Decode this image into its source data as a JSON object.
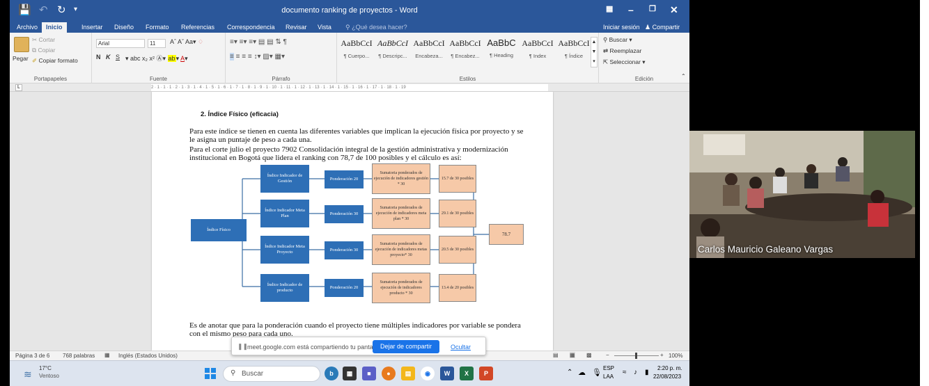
{
  "window": {
    "title": "documento ranking de proyectos  -  Word"
  },
  "menu": {
    "tabs": [
      "Archivo",
      "Inicio",
      "Insertar",
      "Diseño",
      "Formato",
      "Referencias",
      "Correspondencia",
      "Revisar",
      "Vista"
    ],
    "search": "¿Qué desea hacer?",
    "signin": "Iniciar sesión",
    "share": "Compartir"
  },
  "ribbon": {
    "clipboard": {
      "paste": "Pegar",
      "cut": "Cortar",
      "copy": "Copiar",
      "format": "Copiar formato",
      "label": "Portapapeles"
    },
    "font": {
      "name": "Arial",
      "size": "11",
      "label": "Fuente",
      "bold": "N",
      "italic": "K",
      "underline": "S"
    },
    "paragraph": {
      "label": "Párrafo"
    },
    "styles": {
      "items": [
        {
          "sample": "AaBbCcI",
          "name": "¶ Cuerpo..."
        },
        {
          "sample": "AaBbCcI",
          "name": "¶ Descripc..."
        },
        {
          "sample": "AaBbCcI",
          "name": "Encabeza..."
        },
        {
          "sample": "AaBbCcI",
          "name": "¶ Encabez..."
        },
        {
          "sample": "AaBbC",
          "name": "¶ Heading"
        },
        {
          "sample": "AaBbCcI",
          "name": "¶ Index"
        },
        {
          "sample": "AaBbCcI",
          "name": "¶ Índice"
        }
      ],
      "label": "Estilos"
    },
    "editing": {
      "find": "Buscar",
      "replace": "Reemplazar",
      "select": "Seleccionar",
      "label": "Edición"
    }
  },
  "ruler": "2 · 1 · 1 · 1 · 2 · 1 · 3 · 1 · 4 · 1 · 5 · 1 · 6 · 1 · 7 · 1 · 8 · 1 · 9 · 1 · 10 · 1 · 11 · 1 · 12 · 1 · 13 · 1 · 14 · 1 · 15 · 1 · 16 · 1 · 17 · 1 · 18 · 1 · 19",
  "document": {
    "heading": "2.   Índice Físico (eficacia)",
    "para1": "Para este índice se tienen en cuenta las diferentes variables que implican la ejecución física por proyecto y se le asigna un puntaje de peso a cada una.",
    "para2": "Para el corte julio el proyecto 7902 Consolidación integral de la gestión administrativa y modernización institucional en Bogotá que lidera el ranking con 78,7 de 100 posibles y el cálculo es así:",
    "para3": "Es de anotar que para la ponderación cuando el proyecto tiene múltiples indicadores por variable se pondera con el mismo peso para cada uno."
  },
  "diagram": {
    "root": "Índice Físico",
    "total": "78.7",
    "rows": [
      {
        "indicator": "Índice Indicador de Gestión",
        "weight": "Ponderación 20",
        "formula": "Sumatoria ponderados de ejecución de indicadores gestión * 30",
        "score": "15.7 de 30 posibles"
      },
      {
        "indicator": "Índice Indicador Meta Plan",
        "weight": "Ponderación 30",
        "formula": "Sumatoria ponderados de ejecución de indicadores meta plan * 30",
        "score": "29.1 de 30 posibles"
      },
      {
        "indicator": "Índice Indicador Meta Proyecto",
        "weight": "Ponderación 30",
        "formula": "Sumatoria ponderados de ejecución de indicadores metas proyecto* 30",
        "score": "20.5 de 30 posibles"
      },
      {
        "indicator": "Índice Indicador de producto",
        "weight": "Ponderación 20",
        "formula": "Sumatoria ponderados de ejecución de indicadores producto * 30",
        "score": "13.4 de 20 posibles"
      }
    ]
  },
  "status": {
    "page": "Página 3 de 6",
    "words": "768 palabras",
    "lang": "Inglés (Estados Unidos)",
    "zoom": "100%"
  },
  "share": {
    "text": "meet.google.com está compartiendo tu pantalla.",
    "stop": "Dejar de compartir",
    "hide": "Ocultar"
  },
  "taskbar": {
    "temp": "17°C",
    "weather": "Ventoso",
    "search": "Buscar",
    "lang1": "ESP",
    "lang2": "LAA",
    "time": "2:20 p. m.",
    "date": "22/08/2023"
  },
  "video": {
    "name": "Carlos Mauricio Galeano Vargas"
  }
}
